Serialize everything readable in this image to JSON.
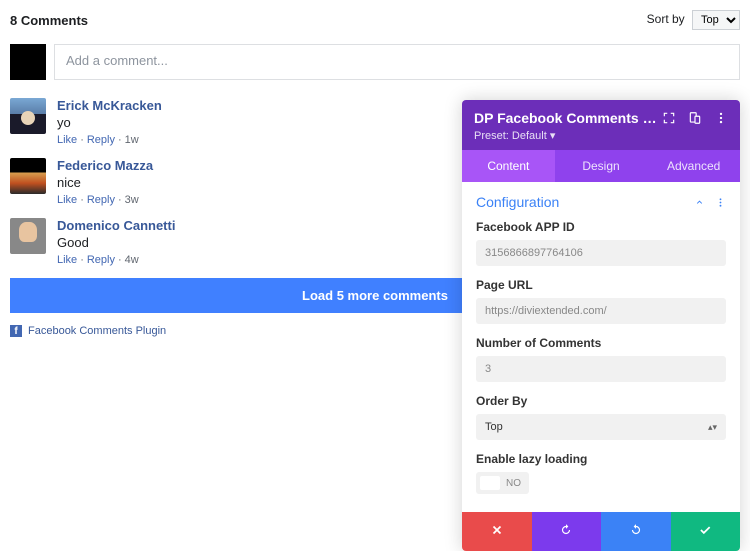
{
  "fb": {
    "count_label": "8 Comments",
    "sort_label": "Sort by",
    "sort_value": "Top",
    "compose_placeholder": "Add a comment...",
    "comments": [
      {
        "author": "Erick McKracken",
        "text": "yo",
        "time": "1w"
      },
      {
        "author": "Federico Mazza",
        "text": "nice",
        "time": "3w"
      },
      {
        "author": "Domenico Cannetti",
        "text": "Good",
        "time": "4w"
      }
    ],
    "like_label": "Like",
    "reply_label": "Reply",
    "load_more": "Load 5 more comments",
    "plugin_note": "Facebook Comments Plugin"
  },
  "panel": {
    "title": "DP Facebook Comments Se...",
    "preset": "Preset: Default",
    "tabs": {
      "content": "Content",
      "design": "Design",
      "advanced": "Advanced"
    },
    "section": "Configuration",
    "fields": {
      "app_id_label": "Facebook APP ID",
      "app_id_value": "3156866897764106",
      "page_url_label": "Page URL",
      "page_url_value": "https://diviextended.com/",
      "num_label": "Number of Comments",
      "num_value": "3",
      "order_label": "Order By",
      "order_value": "Top",
      "lazy_label": "Enable lazy loading",
      "lazy_value": "NO"
    }
  }
}
